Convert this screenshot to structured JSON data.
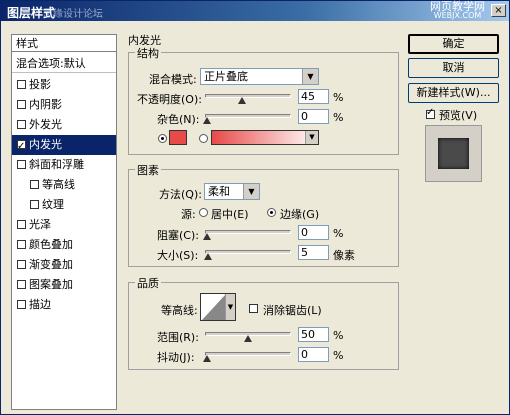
{
  "window": {
    "title": "图层样式",
    "watermark": "思缘设计论坛",
    "site_line1": "网页教学网",
    "site_line2": "WEBJX.COM",
    "close_glyph": "×"
  },
  "left_panel": {
    "header": "样式",
    "blend": "混合选项:默认",
    "items": [
      {
        "label": "投影",
        "checked": false,
        "indent": false,
        "selected": false
      },
      {
        "label": "内阴影",
        "checked": false,
        "indent": false,
        "selected": false
      },
      {
        "label": "外发光",
        "checked": false,
        "indent": false,
        "selected": false
      },
      {
        "label": "内发光",
        "checked": true,
        "indent": false,
        "selected": true
      },
      {
        "label": "斜面和浮雕",
        "checked": false,
        "indent": false,
        "selected": false
      },
      {
        "label": "等高线",
        "checked": false,
        "indent": true,
        "selected": false
      },
      {
        "label": "纹理",
        "checked": false,
        "indent": true,
        "selected": false
      },
      {
        "label": "光泽",
        "checked": false,
        "indent": false,
        "selected": false
      },
      {
        "label": "颜色叠加",
        "checked": false,
        "indent": false,
        "selected": false
      },
      {
        "label": "渐变叠加",
        "checked": false,
        "indent": false,
        "selected": false
      },
      {
        "label": "图案叠加",
        "checked": false,
        "indent": false,
        "selected": false
      },
      {
        "label": "描边",
        "checked": false,
        "indent": false,
        "selected": false
      }
    ]
  },
  "main": {
    "section_title": "内发光",
    "structure": {
      "title": "结构",
      "blend_mode_label": "混合模式:",
      "blend_mode_value": "正片叠底",
      "opacity_label": "不透明度(O):",
      "opacity_value": "45",
      "opacity_unit": "%",
      "noise_label": "杂色(N):",
      "noise_value": "0",
      "noise_unit": "%",
      "color_swatch": "#e84a4a"
    },
    "elements": {
      "title": "图素",
      "method_label": "方法(Q):",
      "method_value": "柔和",
      "source_label": "源:",
      "source_center": "居中(E)",
      "source_edge": "边缘(G)",
      "choke_label": "阻塞(C):",
      "choke_value": "0",
      "choke_unit": "%",
      "size_label": "大小(S):",
      "size_value": "5",
      "size_unit": "像素"
    },
    "quality": {
      "title": "品质",
      "contour_label": "等高线:",
      "antialias_label": "消除锯齿(L)",
      "range_label": "范围(R):",
      "range_value": "50",
      "range_unit": "%",
      "jitter_label": "抖动(J):",
      "jitter_value": "0",
      "jitter_unit": "%"
    }
  },
  "buttons": {
    "ok": "确定",
    "cancel": "取消",
    "new_style": "新建样式(W)...",
    "preview": "预览(V)"
  }
}
